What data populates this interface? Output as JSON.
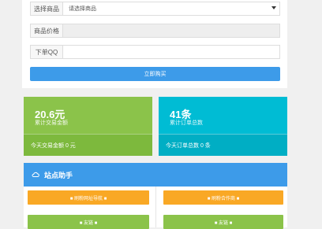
{
  "form": {
    "product_label": "选择商品",
    "product_value": "请选择商品",
    "price_label": "商品价格",
    "price_value": "",
    "qq_label": "下单QQ",
    "qq_value": "",
    "buy_button": "立即购买"
  },
  "stats": {
    "trade_amount": "20.6元",
    "trade_amount_label": "累计交易金额",
    "trade_today": "今天交易金额 0 元",
    "orders_count": "41条",
    "orders_label": "累计订单总数",
    "orders_today": "今天订单总数 0 条"
  },
  "helper": {
    "title": "站点助手",
    "buttons": [
      {
        "label": "■ 刷粉网址导航 ■"
      },
      {
        "label": "■ 刷粉合作商 ■"
      },
      {
        "label": "■ 友链 ■"
      },
      {
        "label": "■ 友链 ■"
      }
    ]
  },
  "colors": {
    "accent_blue": "#3d9be9",
    "card_green": "#8bc34a",
    "card_cyan": "#00bcd4",
    "button_orange": "#f9a825"
  }
}
